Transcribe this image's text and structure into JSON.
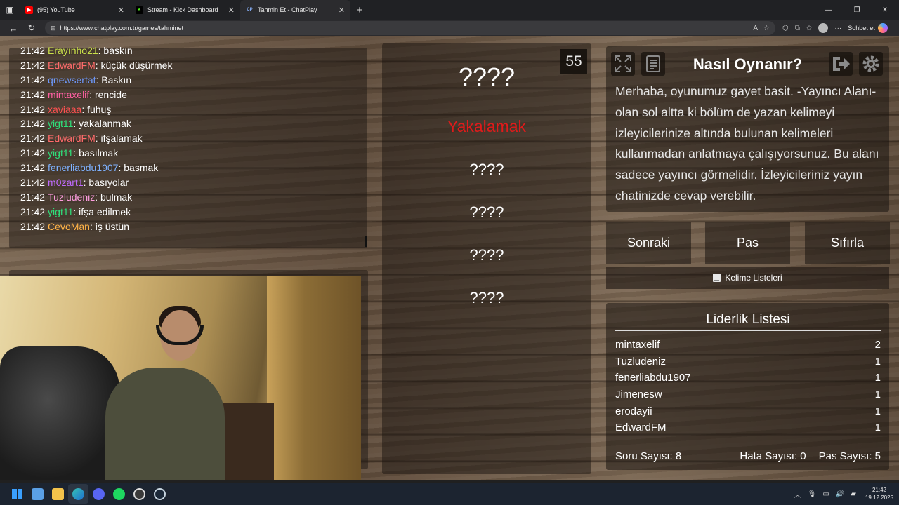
{
  "browser": {
    "tabs": [
      {
        "label": "(95) YouTube",
        "favicon": "youtube-icon"
      },
      {
        "label": "Stream - Kick Dashboard",
        "favicon": "kick-icon"
      },
      {
        "label": "Tahmin Et - ChatPlay",
        "favicon": "chatplay-icon",
        "active": true
      }
    ],
    "url": "https://www.chatplay.com.tr/games/tahminet",
    "chat_button_label": "Sohbet et"
  },
  "chat": {
    "messages": [
      {
        "time": "21:42",
        "user": "Erayınho21",
        "text": ": baskın",
        "color": "#c9e04a"
      },
      {
        "time": "21:42",
        "user": "EdwardFM",
        "text": ": küçük düşürmek",
        "color": "#ff6b6b"
      },
      {
        "time": "21:42",
        "user": "qnewsertat",
        "text": ": Baskın",
        "color": "#6f9bff"
      },
      {
        "time": "21:42",
        "user": "mintaxelif",
        "text": ": rencide",
        "color": "#ff5fa2"
      },
      {
        "time": "21:42",
        "user": "xaviaaa",
        "text": ": fuhuş",
        "color": "#ff5050"
      },
      {
        "time": "21:42",
        "user": "yigt11",
        "text": ": yakalanmak",
        "color": "#2ee07a"
      },
      {
        "time": "21:42",
        "user": "EdwardFM",
        "text": ": ifşalamak",
        "color": "#ff6b6b"
      },
      {
        "time": "21:42",
        "user": "yigt11",
        "text": ": basılmak",
        "color": "#2ee07a"
      },
      {
        "time": "21:42",
        "user": "fenerliabdu1907",
        "text": ": basmak",
        "color": "#7fb2ff"
      },
      {
        "time": "21:42",
        "user": "m0zart1",
        "text": ": basıyolar",
        "color": "#c06bff"
      },
      {
        "time": "21:42",
        "user": "Tuzludeniz",
        "text": ": bulmak",
        "color": "#ff9de0"
      },
      {
        "time": "21:42",
        "user": "yigt11",
        "text": ": ifşa edilmek",
        "color": "#2ee07a"
      },
      {
        "time": "21:42",
        "user": "CevoMan",
        "text": ": iş üstün",
        "color": "#ffb347"
      }
    ]
  },
  "game": {
    "timer": "55",
    "main_word": "????",
    "forbidden_word": "Yakalamak",
    "hidden_words": [
      "????",
      "????",
      "????",
      "????"
    ]
  },
  "howto": {
    "title": "Nasıl Oynanır?",
    "text": "Merhaba, oyunumuz gayet basit. -Yayıncı Alanı- olan sol altta ki bölüm de yazan kelimeyi izleyicilerinize altında bulunan kelimeleri kullanmadan anlatmaya çalışıyorsunuz. Bu alanı sadece yayıncı görmelidir. İzleyicileriniz yayın chatinizde cevap verebilir."
  },
  "actions": {
    "next": "Sonraki",
    "pass": "Pas",
    "reset": "Sıfırla",
    "word_lists": "Kelime Listeleri"
  },
  "leaderboard": {
    "title": "Liderlik Listesi",
    "rows": [
      {
        "name": "mintaxelif",
        "score": "2"
      },
      {
        "name": "Tuzludeniz",
        "score": "1"
      },
      {
        "name": "fenerliabdu1907",
        "score": "1"
      },
      {
        "name": "Jimenesw",
        "score": "1"
      },
      {
        "name": "erodayii",
        "score": "1"
      },
      {
        "name": "EdwardFM",
        "score": "1"
      }
    ]
  },
  "stats": {
    "questions": "Soru Sayısı: 8",
    "errors": "Hata Sayısı: 0",
    "passes": "Pas Sayısı: 5"
  },
  "taskbar": {
    "time": "21:42",
    "date": "19.12.2025"
  }
}
